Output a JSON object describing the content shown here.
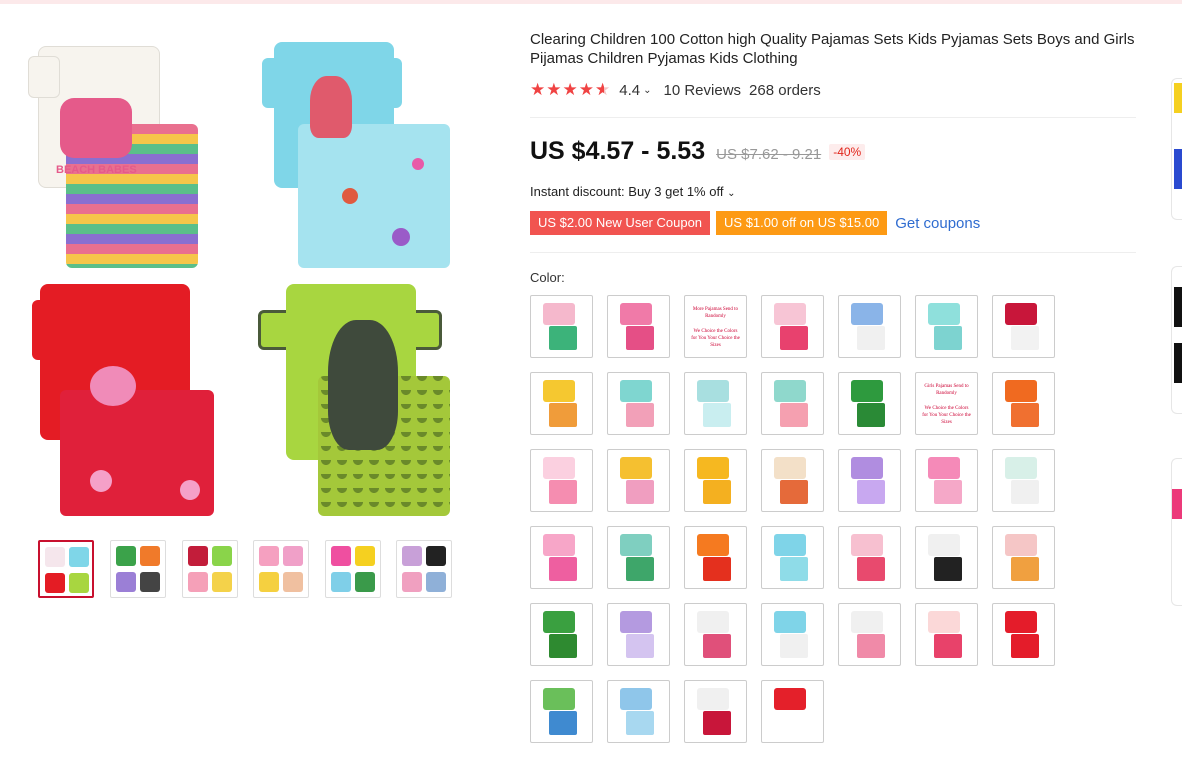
{
  "product": {
    "title": "Clearing Children 100 Cotton high Quality Pajamas Sets Kids Pyjamas Sets Boys and Girls Pijamas Children Pyjamas Kids Clothing",
    "rating_value": "4.4",
    "rating_stars": 4.4,
    "reviews": "10 Reviews",
    "orders": "268 orders"
  },
  "price": {
    "current": "US $4.57 - 5.53",
    "original": "US $7.62 - 9.21",
    "discount": "-40%"
  },
  "instant_discount": "Instant discount: Buy 3 get 1% off",
  "coupons": {
    "new_user": "US $2.00 New User Coupon",
    "store": "US $1.00 off on US $15.00",
    "get_label": "Get coupons"
  },
  "color_label": "Color:",
  "gallery": {
    "images": [
      {
        "name": "beach-babes-pajama",
        "shirt": "#f7f4ee",
        "pants": "#e9708f",
        "art": "#e55a8a",
        "text": "BEACH BABES"
      },
      {
        "name": "mermaid-pajama",
        "shirt": "#7fd6e8",
        "pants": "#9fe0ee",
        "art": "#e05a6c"
      },
      {
        "name": "octopus-pajama",
        "shirt": "#e41c24",
        "pants": "#e0203a",
        "art": "#f08bb8"
      },
      {
        "name": "dinosaur-pajama",
        "shirt": "#a8d640",
        "pants": "#a4c83a",
        "art": "#3f4a3c"
      }
    ],
    "selected_thumb": 0
  },
  "thumbs": [
    [
      "#f5e6ec",
      "#7fd6e8",
      "#e41c24",
      "#a8d640"
    ],
    [
      "#3ba24a",
      "#f07a2a",
      "#9b7fd6",
      "#444444"
    ],
    [
      "#c21d3a",
      "#8ad44a",
      "#f5a0b8",
      "#f4d24a"
    ],
    [
      "#f5a0c0",
      "#f0a0c8",
      "#f5d040",
      "#f0c0a0"
    ],
    [
      "#ef4fa0",
      "#f5d020",
      "#7fcfe8",
      "#3a9a4a"
    ],
    [
      "#c8a0d8",
      "#222222",
      "#f0a0c0",
      "#8fb0d8"
    ]
  ],
  "colors": [
    {
      "shirt": "#f5b8cc",
      "pants": "#3cb37a"
    },
    {
      "shirt": "#f07aa8",
      "pants": "#e54f86"
    },
    {
      "type": "text",
      "line1": "More Pajamas Send to Randomly",
      "line2": "We Choice the Colors for You Your Choice the Sizes"
    },
    {
      "shirt": "#f7c5d5",
      "pants": "#e8416e"
    },
    {
      "shirt": "#8ab4e8",
      "pants": "#f0f0f0"
    },
    {
      "shirt": "#8fe0dc",
      "pants": "#7dd3d0"
    },
    {
      "shirt": "#c8163a",
      "pants": "#f2f2f2"
    },
    {
      "shirt": "#f5c830",
      "pants": "#f09c3a"
    },
    {
      "shirt": "#7fd6d0",
      "pants": "#f2a0b8"
    },
    {
      "shirt": "#a8dfe0",
      "pants": "#c9eef0"
    },
    {
      "shirt": "#8fd8cc",
      "pants": "#f5a0b0"
    },
    {
      "shirt": "#2e9a3e",
      "pants": "#2a8a36"
    },
    {
      "type": "text",
      "line1": "Girls Pajamas Send to Randomly",
      "line2": "We Choice the Colors for You Your Choice the Sizes"
    },
    {
      "shirt": "#f06a20",
      "pants": "#f07030"
    },
    {
      "shirt": "#fbd0e0",
      "pants": "#f58db0"
    },
    {
      "shirt": "#f5c030",
      "pants": "#f09ec0"
    },
    {
      "shirt": "#f6b820",
      "pants": "#f4b020"
    },
    {
      "shirt": "#f3e0c8",
      "pants": "#e56a3a"
    },
    {
      "shirt": "#b08de0",
      "pants": "#c8a8f0"
    },
    {
      "shirt": "#f58ab8",
      "pants": "#f5a8c8"
    },
    {
      "shirt": "#d8f0e8",
      "pants": "#f0f0f0"
    },
    {
      "shirt": "#f7a6c8",
      "pants": "#ee5fa0"
    },
    {
      "shirt": "#7fcfc0",
      "pants": "#3ea66a"
    },
    {
      "shirt": "#f57a20",
      "pants": "#e4301e"
    },
    {
      "shirt": "#7fd4e8",
      "pants": "#8fdce8"
    },
    {
      "shirt": "#f7c0d0",
      "pants": "#e84a6e"
    },
    {
      "shirt": "#f0f0f0",
      "pants": "#222222"
    },
    {
      "shirt": "#f5c6c6",
      "pants": "#f0a040"
    },
    {
      "shirt": "#3aa040",
      "pants": "#2e8a30"
    },
    {
      "shirt": "#b49ae0",
      "pants": "#d4c4f0"
    },
    {
      "shirt": "#f0f0f0",
      "pants": "#e0507a"
    },
    {
      "shirt": "#7fd4e8",
      "pants": "#f0f0f0"
    },
    {
      "shirt": "#f0f0f0",
      "pants": "#f08aa8"
    },
    {
      "shirt": "#fbd8d8",
      "pants": "#e8426a"
    },
    {
      "shirt": "#e41c2a",
      "pants": "#e41c2a"
    },
    {
      "shirt": "#6abf5a",
      "pants": "#3f8ad0"
    },
    {
      "shirt": "#8fc6ea",
      "pants": "#a8d8f0"
    },
    {
      "shirt": "#f0f0f0",
      "pants": "#c8163a"
    },
    {
      "shirt": "#e4202a",
      "pants": "#ffffff"
    }
  ]
}
